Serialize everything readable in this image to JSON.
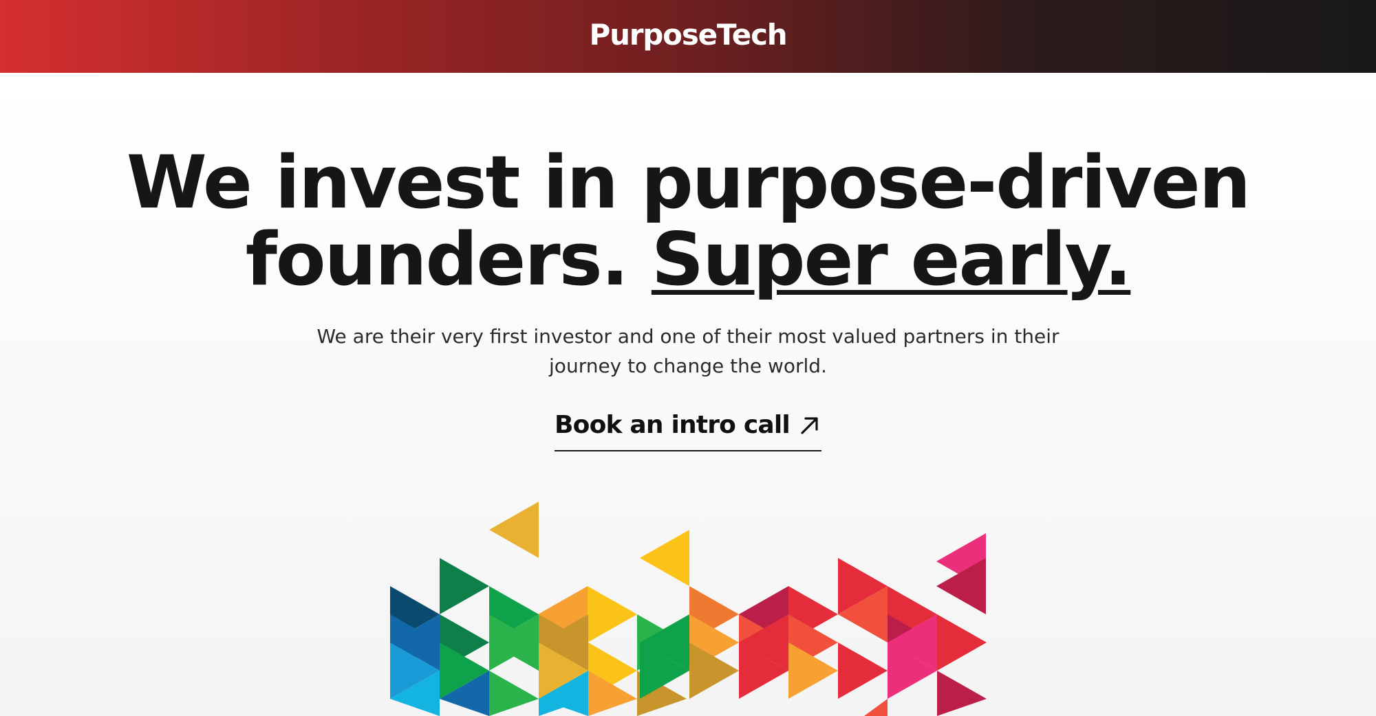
{
  "header": {
    "logo_text": "PurposeTech",
    "gradient_colors": [
      "#d52f2f",
      "#181818"
    ]
  },
  "hero": {
    "headline_line1": "We invest in purpose-driven",
    "headline_line2_prefix": "founders. ",
    "headline_emphasis": "Super early.",
    "subtext": "We are their very first investor and one of their most valued partners in their journey to change the world.",
    "cta_label": "Book an intro call",
    "cta_icon": "arrow-up-right-icon"
  },
  "mosaic": {
    "palette": [
      "#0b4a6f",
      "#1268a8",
      "#1a9bd7",
      "#14b4e0",
      "#0f7f4a",
      "#0ea24a",
      "#2ab34b",
      "#e8b132",
      "#fbc317",
      "#f7a033",
      "#c8952d",
      "#ee7a31",
      "#f0503c",
      "#e52c3a",
      "#ba1e49",
      "#ec2f7a"
    ]
  }
}
